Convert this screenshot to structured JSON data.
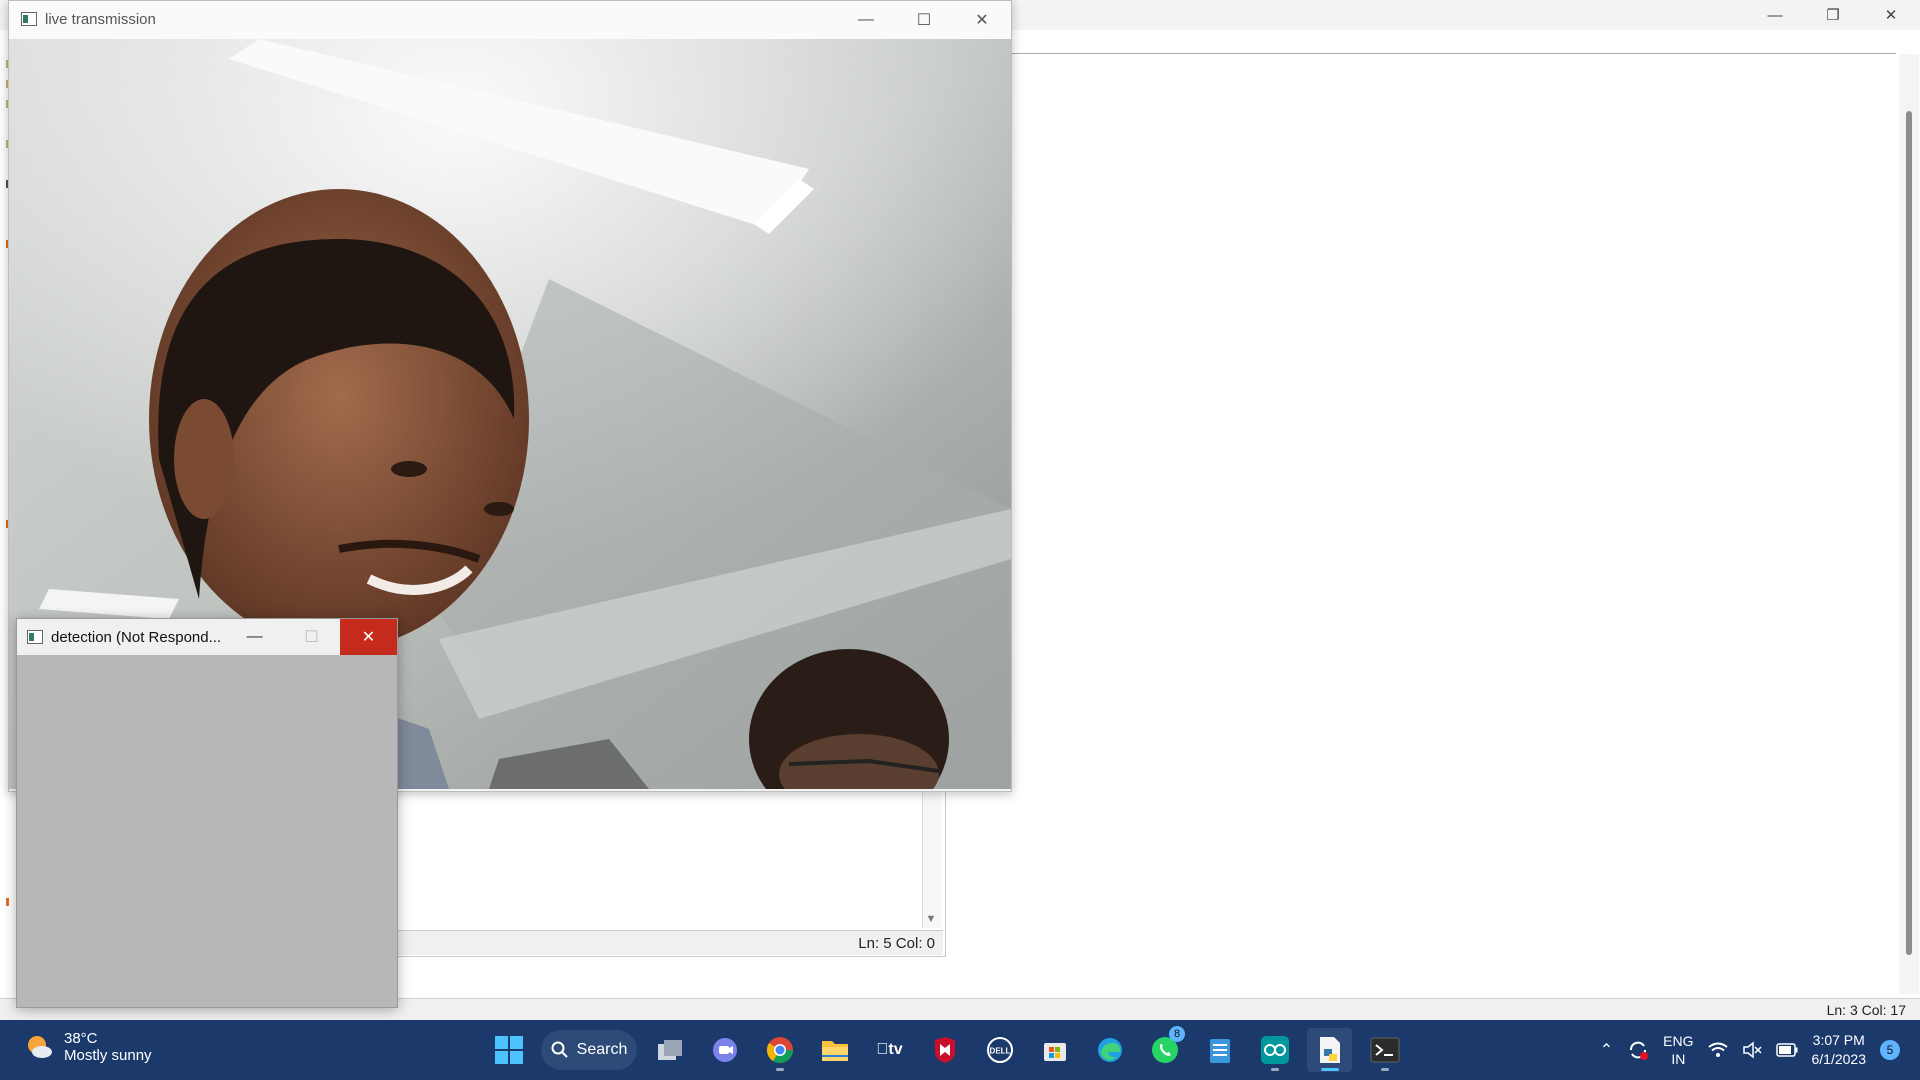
{
  "background_editor": {
    "status": "Ln: 3   Col: 17"
  },
  "idle_editor": {
    "status": "Ln: 5   Col: 0"
  },
  "live_window": {
    "title": "live transmission"
  },
  "detection_window": {
    "title": "detection (Not Respond..."
  },
  "taskbar": {
    "weather_temp": "38°C",
    "weather_desc": "Mostly sunny",
    "search_label": "Search",
    "whatsapp_badge": "8",
    "lang_line1": "ENG",
    "lang_line2": "IN",
    "time": "3:07 PM",
    "date": "6/1/2023",
    "notification_count": "5"
  },
  "colors": {
    "taskbar_bg": "#1b3a6b",
    "close_hover_red": "#c42b1c",
    "accent_blue": "#0067c0"
  }
}
